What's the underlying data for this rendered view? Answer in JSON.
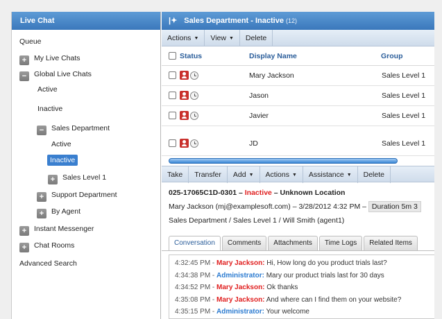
{
  "left_panel": {
    "title": "Live Chat",
    "items": [
      {
        "label": "Queue",
        "expander": ""
      },
      {
        "label": "My Live Chats",
        "expander": "+"
      },
      {
        "label": "Global Live Chats",
        "expander": "−"
      },
      {
        "label": "Active",
        "expander": ""
      },
      {
        "label": "Inactive",
        "expander": ""
      },
      {
        "label": "Sales Department",
        "expander": "−"
      },
      {
        "label": "Active",
        "expander": ""
      },
      {
        "label": "Inactive",
        "expander": "",
        "selected": true
      },
      {
        "label": "Sales Level 1",
        "expander": "+"
      },
      {
        "label": "Support Department",
        "expander": "+"
      },
      {
        "label": "By Agent",
        "expander": "+"
      },
      {
        "label": "Instant Messenger",
        "expander": "+"
      },
      {
        "label": "Chat Rooms",
        "expander": "+"
      },
      {
        "label": "Advanced Search",
        "expander": ""
      }
    ]
  },
  "header": {
    "pin_glyph": "|✦",
    "title": "Sales Department - Inactive",
    "count": "(12)"
  },
  "toolbar": {
    "actions": "Actions",
    "view": "View",
    "delete": "Delete"
  },
  "table": {
    "columns": {
      "status": "Status",
      "display_name": "Display Name",
      "group": "Group"
    },
    "rows": [
      {
        "name": "Mary Jackson",
        "group": "Sales Level 1"
      },
      {
        "name": "Jason",
        "group": "Sales Level 1"
      },
      {
        "name": "Javier",
        "group": "Sales Level 1"
      },
      {
        "name": "JD",
        "group": "Sales Level 1"
      }
    ]
  },
  "chat_toolbar": {
    "take": "Take",
    "transfer": "Transfer",
    "add": "Add",
    "actions": "Actions",
    "assistance": "Assistance",
    "delete": "Delete"
  },
  "chat_info": {
    "id": "025-17065C1D-0301",
    "sep1": " – ",
    "status": "Inactive",
    "location": " – Unknown Location",
    "line2": "Mary Jackson (mj@examplesoft.com) – 3/28/2012 4:32 PM – ",
    "duration": "Duration 5m 3",
    "line3": "Sales Department / Sales Level 1 / Will Smith (agent1)"
  },
  "tabs": [
    "Conversation",
    "Comments",
    "Attachments",
    "Time Logs",
    "Related Items"
  ],
  "conversation": [
    {
      "time": "4:32:45 PM - ",
      "who": "Mary Jackson:",
      "role": "user",
      "msg": " Hi, How long do you product trials last?"
    },
    {
      "time": "4:34:38 PM - ",
      "who": "Administrator:",
      "role": "admin",
      "msg": " Mary our product trials last for 30 days"
    },
    {
      "time": "4:34:52 PM - ",
      "who": "Mary Jackson:",
      "role": "user",
      "msg": " Ok thanks"
    },
    {
      "time": "4:35:08 PM - ",
      "who": "Mary Jackson:",
      "role": "user",
      "msg": " And where can I find them on your website?"
    },
    {
      "time": "4:35:15 PM - ",
      "who": "Administrator:",
      "role": "admin",
      "msg": " Your welcome"
    }
  ],
  "colors": {
    "header_blue": "#3a78bc",
    "inactive_red": "#e02020",
    "admin_blue": "#2a7ad0"
  }
}
